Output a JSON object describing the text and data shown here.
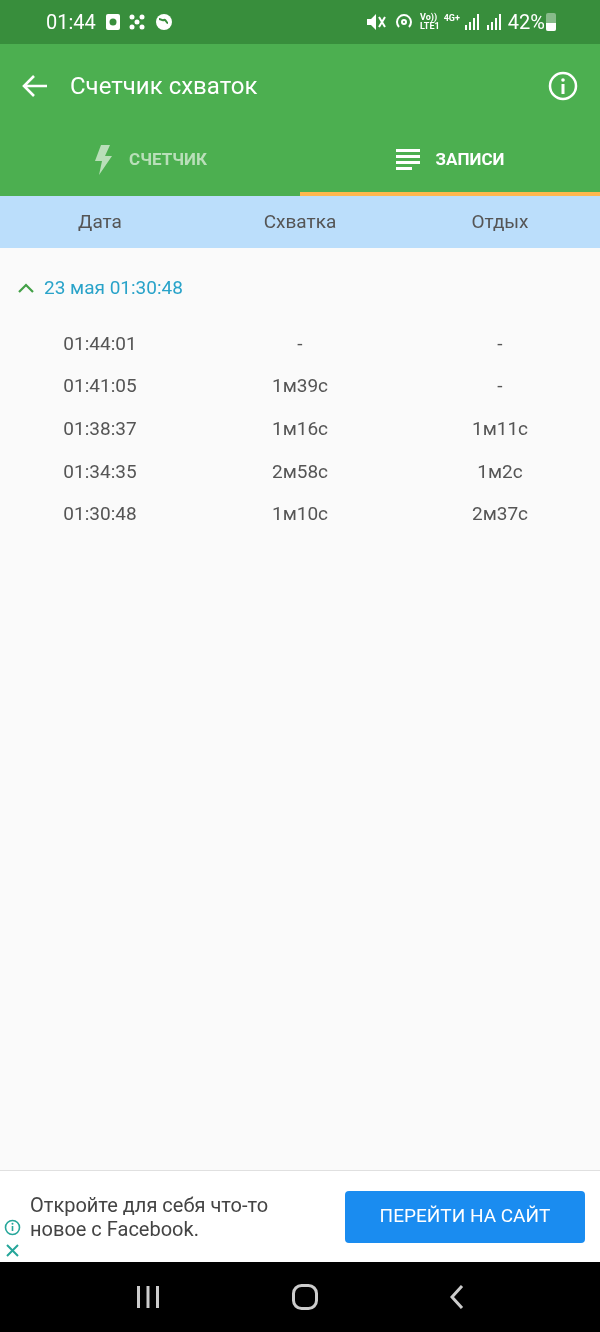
{
  "status_bar": {
    "time": "01:44",
    "volte": "Vo))",
    "lte": "LTE1",
    "network": "4G+",
    "battery": "42%"
  },
  "app_bar": {
    "title": "Счетчик схваток"
  },
  "tabs": [
    {
      "kind": "counter",
      "label": "СЧЕТЧИК",
      "selected": false
    },
    {
      "kind": "records",
      "label": "ЗАПИСИ",
      "selected": true
    }
  ],
  "table": {
    "columns": [
      "Дата",
      "Схватка",
      "Отдых"
    ],
    "groups": [
      {
        "title": "23 мая 01:30:48",
        "expanded": true,
        "rows": [
          [
            "01:44:01",
            "-",
            "-"
          ],
          [
            "01:41:05",
            "1м39с",
            "-"
          ],
          [
            "01:38:37",
            "1м16с",
            "1м11с"
          ],
          [
            "01:34:35",
            "2м58с",
            "1м2с"
          ],
          [
            "01:30:48",
            "1м10с",
            "2м37с"
          ]
        ]
      }
    ]
  },
  "ad": {
    "text": "Откройте для себя что-то новое с Facebook.",
    "button": "ПЕРЕЙТИ НА САЙТ"
  }
}
